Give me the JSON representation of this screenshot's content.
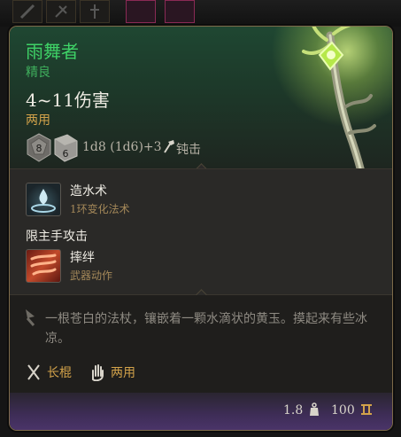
{
  "item": {
    "name": "雨舞者",
    "rarity": "精良",
    "damage": "4~11伤害",
    "handedness": "两用",
    "dice_formula": "1d8 (1d6)+3",
    "damage_type": "钝击",
    "dice_values": [
      "8",
      "6"
    ]
  },
  "spells": [
    {
      "name": "造水术",
      "subtitle": "1环变化法术",
      "icon": "water-drop-icon"
    },
    {
      "name": "摔绊",
      "subtitle": "武器动作",
      "icon": "topple-icon"
    }
  ],
  "main_hand_label": "限主手攻击",
  "description": "一根苍白的法杖，镶嵌着一颗水滴状的黄玉。摸起来有些冰凉。",
  "properties": [
    {
      "label": "长棍",
      "icon": "quarterstaff-icon"
    },
    {
      "label": "两用",
      "icon": "hand-icon"
    }
  ],
  "footer": {
    "weight": "1.8",
    "price": "100"
  },
  "colors": {
    "name": "#3fd267",
    "accent_gold": "#d2a24a",
    "frame": "#7d6a49"
  }
}
